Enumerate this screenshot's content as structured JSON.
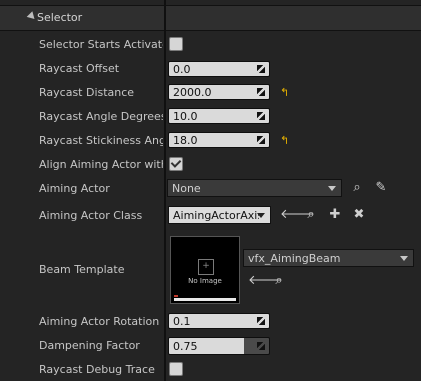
{
  "section": {
    "title": "Selector"
  },
  "rows": {
    "selector_starts_activated": {
      "label": "Selector Starts Activated",
      "checked": false
    },
    "raycast_offset": {
      "label": "Raycast Offset",
      "value": "0.0"
    },
    "raycast_distance": {
      "label": "Raycast Distance",
      "value": "2000.0",
      "reset_icon": "reset-arrow-icon"
    },
    "raycast_angle_degrees": {
      "label": "Raycast Angle Degrees",
      "value": "10.0"
    },
    "raycast_stickiness_angle": {
      "label": "Raycast Stickiness Angle",
      "value": "18.0",
      "reset_icon": "reset-arrow-icon"
    },
    "align_aiming_actor": {
      "label": "Align Aiming Actor with Hit",
      "checked": true
    },
    "aiming_actor": {
      "label": "Aiming Actor",
      "value": "None"
    },
    "aiming_actor_class": {
      "label": "Aiming Actor Class",
      "value": "AimingActorAxis"
    },
    "beam_template": {
      "label": "Beam Template",
      "value": "vfx_AimingBeam",
      "thumbnail_text": "No Image"
    },
    "aiming_actor_rotation_rate": {
      "label": "Aiming Actor Rotation Rate",
      "value": "0.1"
    },
    "dampening_factor": {
      "label": "Dampening Factor",
      "value": "0.75",
      "fraction": 0.75
    },
    "raycast_debug_trace": {
      "label": "Raycast Debug Trace",
      "checked": false
    }
  },
  "colors": {
    "reset_accent": "#e6b200",
    "field_bg": "#dadada",
    "panel_bg": "#242424"
  }
}
